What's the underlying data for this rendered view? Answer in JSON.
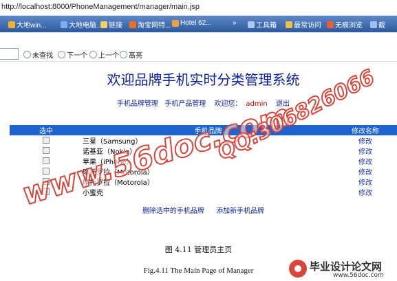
{
  "browser": {
    "url": "http://localhost:8000/PhoneManagement/manager/main.jsp",
    "favorites": [
      {
        "label": "大地win...",
        "color": "#f0b030"
      },
      {
        "label": "大地电脑...",
        "color": "#7ab0f0"
      },
      {
        "label": "链接",
        "color": "#f3d06a"
      },
      {
        "label": "淘宝网特...",
        "color": "#f07020"
      },
      {
        "label": "Hotel 62...",
        "color": "#f0a040"
      },
      {
        "label": "»",
        "color": ""
      },
      {
        "label": "工具箱",
        "color": "#b0c8f0"
      },
      {
        "label": "最常访问",
        "color": "#f0c040"
      },
      {
        "label": "无痕浏览",
        "color": "#e86030"
      },
      {
        "label": "截",
        "color": "#a0c0f0"
      }
    ],
    "find_bar": {
      "not_found": "未查找",
      "next": "下一个",
      "prev": "上一个",
      "highlight": "高亮"
    }
  },
  "page": {
    "title": "欢迎品牌手机实时分类管理系统",
    "nav": {
      "brand_mgmt": "手机品牌管理",
      "product_mgmt": "手机产品管理",
      "welcome": "欢迎您：",
      "user": "admin",
      "logout": "退出"
    },
    "table": {
      "headers": [
        "选中",
        "手机品牌",
        "修改名称"
      ],
      "rows": [
        {
          "brand": "三星（Samsung）",
          "action": "修改"
        },
        {
          "brand": "诺基亚（Nokia）",
          "action": "修改"
        },
        {
          "brand": "苹果（iPhone）",
          "action": "修改"
        },
        {
          "brand": "摩托罗拉（Motorola）",
          "action": "修改"
        },
        {
          "brand": "摩托罗拉（Motorola）",
          "action": "修改"
        },
        {
          "brand": "小蜜壳",
          "action": "修改"
        }
      ]
    },
    "delete_link": "删除选中的手机品牌",
    "add_link": "添加新手机品牌"
  },
  "watermark": {
    "site": "www.56doc.com",
    "qq": "QQ:306826066"
  },
  "caption": {
    "cn": "图 4.11   管理员主页",
    "en": "Fig.4.11    The Main Page of Manager"
  },
  "logo": {
    "name": "毕业设计论文网",
    "site": "www.56doc.com"
  }
}
